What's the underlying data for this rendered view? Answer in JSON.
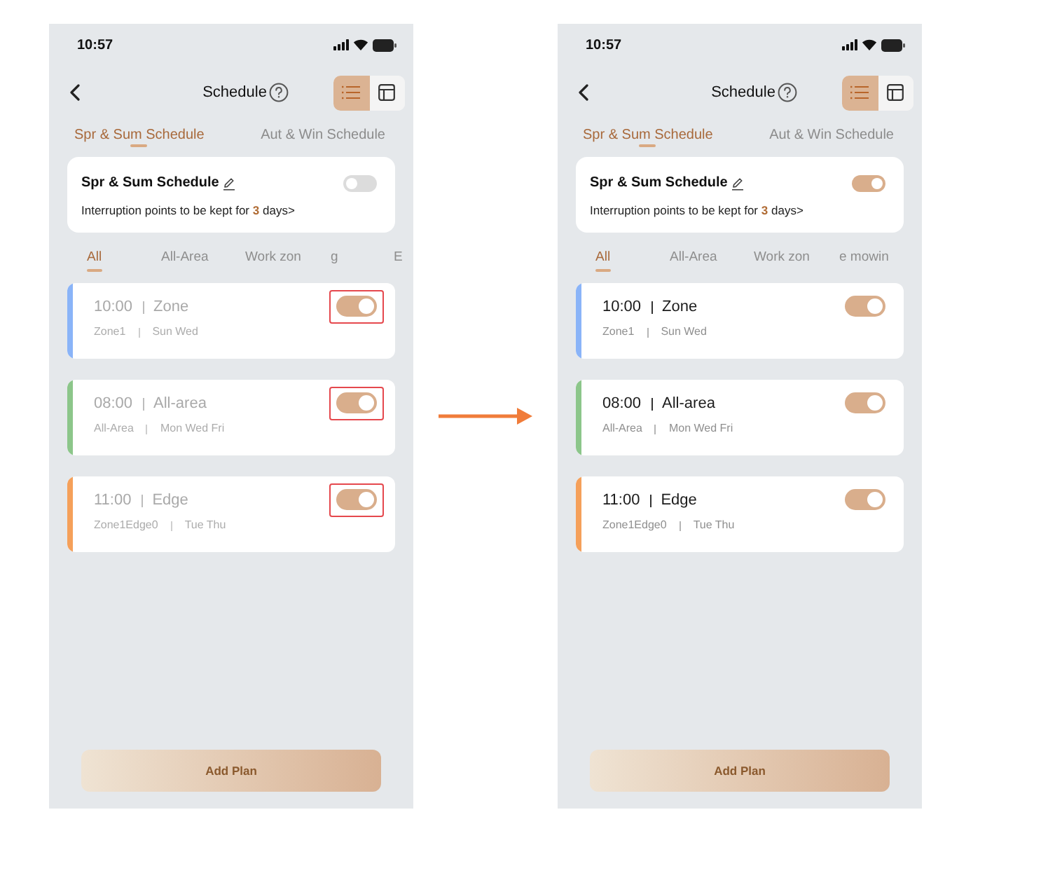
{
  "screens": [
    {
      "status_bar": {
        "time": "10:57"
      },
      "header": {
        "title": "Schedule",
        "view_modes": [
          {
            "kind": "list",
            "selected": true
          },
          {
            "kind": "grid",
            "selected": false
          }
        ]
      },
      "season_tabs": [
        {
          "label": "Spr & Sum Schedule",
          "selected": true
        },
        {
          "label": "Aut & Win Schedule",
          "selected": false
        }
      ],
      "plan": {
        "title": "Spr & Sum Schedule",
        "on": false,
        "note": "Interruption points to be kept for **3** days>"
      },
      "filter_tabs": [
        {
          "label": "All",
          "selected": true
        },
        {
          "label": "All-Area",
          "selected": false
        },
        {
          "label": "Work zon",
          "selected": false
        },
        {
          "label": "g",
          "selected": false
        },
        {
          "label": "E",
          "selected": false
        }
      ],
      "schedules": [
        {
          "time": "10:00",
          "name": "Zone",
          "area": "Zone1",
          "days": "Sun Wed",
          "color": "#8ab4f8",
          "on": true,
          "highlighted": true
        },
        {
          "time": "08:00",
          "name": "All-area",
          "area": "All-Area",
          "days": "Mon Wed Fri",
          "color": "#8cc68a",
          "on": true,
          "highlighted": true
        },
        {
          "time": "11:00",
          "name": "Edge",
          "area": "Zone1Edge0",
          "days": "Tue Thu",
          "color": "#f5a05a",
          "on": true,
          "highlighted": true
        }
      ],
      "add_button": "Add Plan"
    },
    {
      "status_bar": {
        "time": "10:57"
      },
      "header": {
        "title": "Schedule",
        "view_modes": [
          {
            "kind": "list",
            "selected": true
          },
          {
            "kind": "grid",
            "selected": false
          }
        ]
      },
      "season_tabs": [
        {
          "label": "Spr & Sum Schedule",
          "selected": true
        },
        {
          "label": "Aut & Win Schedule",
          "selected": false
        }
      ],
      "plan": {
        "title": "Spr & Sum Schedule",
        "on": true,
        "note": "Interruption points to be kept for **3** days>"
      },
      "filter_tabs": [
        {
          "label": "All",
          "selected": true
        },
        {
          "label": "All-Area",
          "selected": false
        },
        {
          "label": "Work zon",
          "selected": false
        },
        {
          "label": "e mowin",
          "selected": false
        }
      ],
      "schedules": [
        {
          "time": "10:00",
          "name": "Zone",
          "area": "Zone1",
          "days": "Sun Wed",
          "color": "#8ab4f8",
          "on": true,
          "highlighted": false
        },
        {
          "time": "08:00",
          "name": "All-area",
          "area": "All-Area",
          "days": "Mon Wed Fri",
          "color": "#8cc68a",
          "on": true,
          "highlighted": false
        },
        {
          "time": "11:00",
          "name": "Edge",
          "area": "Zone1Edge0",
          "days": "Tue Thu",
          "color": "#f5a05a",
          "on": true,
          "highlighted": false
        }
      ],
      "add_button": "Add Plan"
    }
  ]
}
